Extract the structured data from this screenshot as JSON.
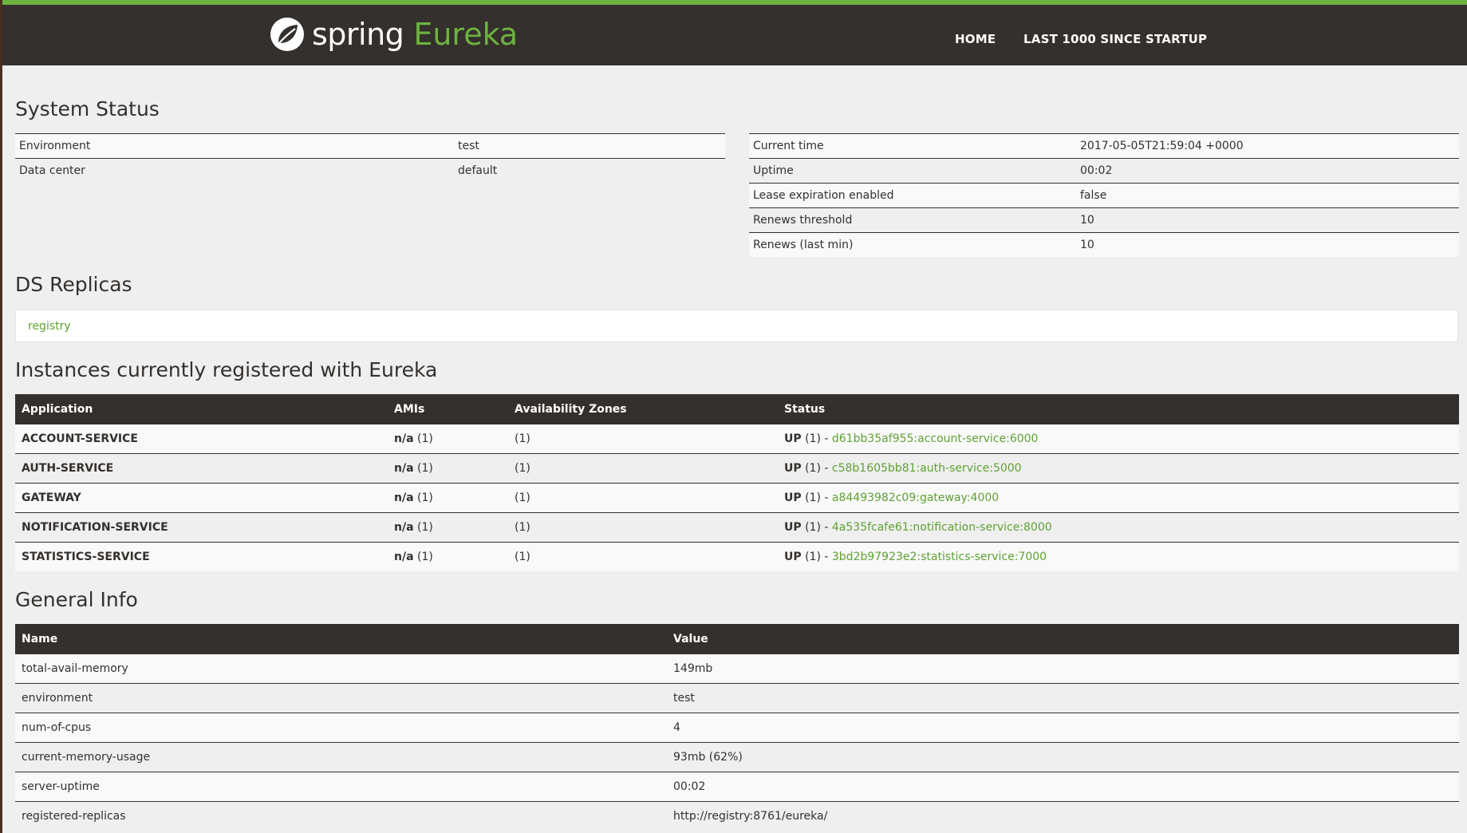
{
  "header": {
    "brand_word": "spring",
    "product_word": "Eureka",
    "nav": {
      "home": "HOME",
      "last": "LAST 1000 SINCE STARTUP"
    }
  },
  "colors": {
    "brand_green": "#6db33f",
    "header_bg": "#34302d",
    "page_bg": "#efefef"
  },
  "system_status": {
    "title": "System Status",
    "left": [
      {
        "label": "Environment",
        "value": "test"
      },
      {
        "label": "Data center",
        "value": "default"
      }
    ],
    "right": [
      {
        "label": "Current time",
        "value": "2017-05-05T21:59:04 +0000"
      },
      {
        "label": "Uptime",
        "value": "00:02"
      },
      {
        "label": "Lease expiration enabled",
        "value": "false"
      },
      {
        "label": "Renews threshold",
        "value": "10"
      },
      {
        "label": "Renews (last min)",
        "value": "10"
      }
    ]
  },
  "ds_replicas": {
    "title": "DS Replicas",
    "replica": "registry"
  },
  "instances": {
    "title": "Instances currently registered with Eureka",
    "columns": [
      "Application",
      "AMIs",
      "Availability Zones",
      "Status"
    ],
    "rows": [
      {
        "app": "ACCOUNT-SERVICE",
        "ami_label": "n/a",
        "ami_count": "(1)",
        "zones": "(1)",
        "status_label": "UP",
        "status_count": "(1) -",
        "instance": "d61bb35af955:account-service:6000"
      },
      {
        "app": "AUTH-SERVICE",
        "ami_label": "n/a",
        "ami_count": "(1)",
        "zones": "(1)",
        "status_label": "UP",
        "status_count": "(1) -",
        "instance": "c58b1605bb81:auth-service:5000"
      },
      {
        "app": "GATEWAY",
        "ami_label": "n/a",
        "ami_count": "(1)",
        "zones": "(1)",
        "status_label": "UP",
        "status_count": "(1) -",
        "instance": "a84493982c09:gateway:4000"
      },
      {
        "app": "NOTIFICATION-SERVICE",
        "ami_label": "n/a",
        "ami_count": "(1)",
        "zones": "(1)",
        "status_label": "UP",
        "status_count": "(1) -",
        "instance": "4a535fcafe61:notification-service:8000"
      },
      {
        "app": "STATISTICS-SERVICE",
        "ami_label": "n/a",
        "ami_count": "(1)",
        "zones": "(1)",
        "status_label": "UP",
        "status_count": "(1) -",
        "instance": "3bd2b97923e2:statistics-service:7000"
      }
    ]
  },
  "general_info": {
    "title": "General Info",
    "columns": [
      "Name",
      "Value"
    ],
    "rows": [
      {
        "name": "total-avail-memory",
        "value": "149mb"
      },
      {
        "name": "environment",
        "value": "test"
      },
      {
        "name": "num-of-cpus",
        "value": "4"
      },
      {
        "name": "current-memory-usage",
        "value": "93mb (62%)"
      },
      {
        "name": "server-uptime",
        "value": "00:02"
      },
      {
        "name": "registered-replicas",
        "value": "http://registry:8761/eureka/"
      }
    ]
  }
}
